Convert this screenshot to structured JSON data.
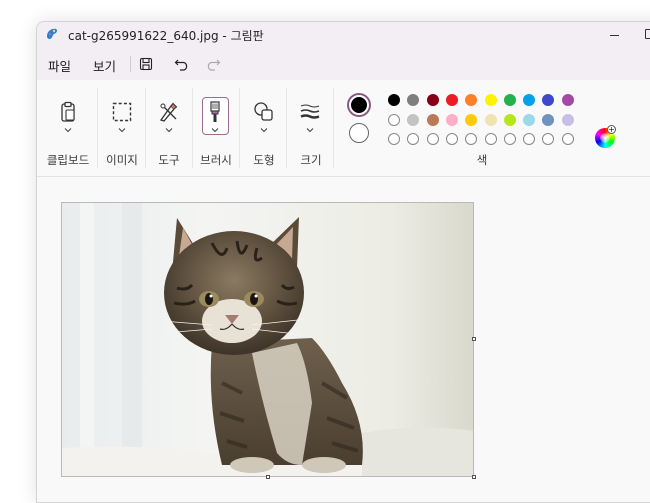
{
  "window": {
    "title": "cat-g265991622_640.jpg - 그림판"
  },
  "menu": {
    "file": "파일",
    "view": "보기"
  },
  "ribbon": {
    "groups": [
      {
        "label": "클립보드",
        "icon": "clipboard-icon"
      },
      {
        "label": "이미지",
        "icon": "selection-icon"
      },
      {
        "label": "도구",
        "icon": "tools-icon"
      },
      {
        "label": "브러시",
        "icon": "brush-icon"
      },
      {
        "label": "도형",
        "icon": "shapes-icon"
      },
      {
        "label": "크기",
        "icon": "size-icon"
      }
    ],
    "colors_label": "색"
  },
  "colors": {
    "primary": "#000000",
    "secondary": "#ffffff",
    "palette_row1": [
      "#000000",
      "#7f7f7f",
      "#880015",
      "#ed1c24",
      "#ff7f27",
      "#fff200",
      "#22b14c",
      "#00a2e8",
      "#3f48cc",
      "#a349a4"
    ],
    "palette_row2": [
      "#ffffff",
      "#c3c3c3",
      "#b97a57",
      "#ffaec9",
      "#ffc90e",
      "#efe4b0",
      "#b5e61d",
      "#99d9ea",
      "#7092be",
      "#c8bfe7"
    ],
    "palette_row3": [
      "#ffffff",
      "#ffffff",
      "#ffffff",
      "#ffffff",
      "#ffffff",
      "#ffffff",
      "#ffffff",
      "#ffffff",
      "#ffffff",
      "#ffffff"
    ]
  },
  "canvas": {
    "image_subject": "tabby kitten photo"
  }
}
